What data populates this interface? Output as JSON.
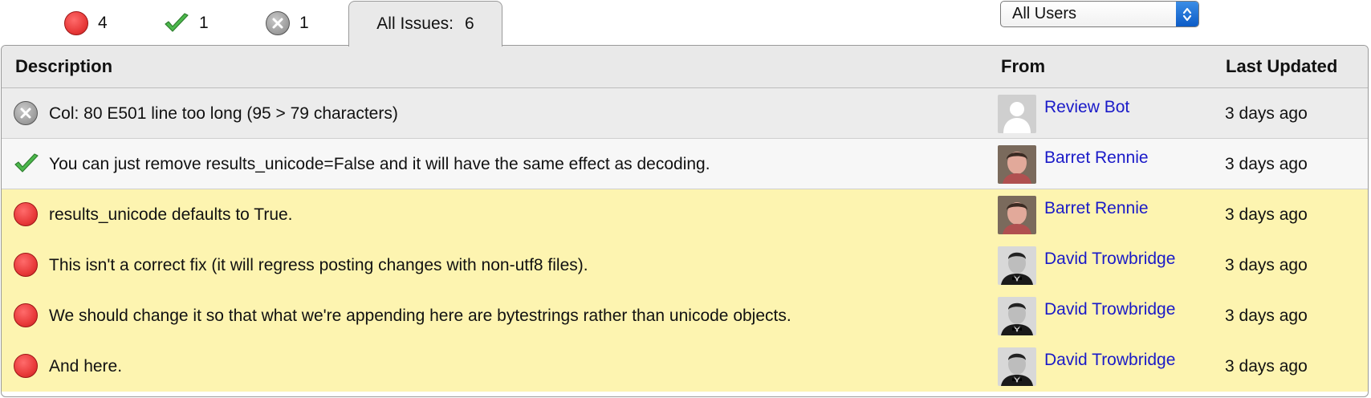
{
  "tabs": {
    "open": {
      "icon": "open-issue-icon",
      "count": "4"
    },
    "fixed": {
      "icon": "fixed-check-icon",
      "count": "1"
    },
    "dropped": {
      "icon": "dropped-x-icon",
      "count": "1"
    },
    "all": {
      "label": "All Issues:",
      "count": "6"
    }
  },
  "filter": {
    "selected": "All Users"
  },
  "table": {
    "headers": {
      "description": "Description",
      "from": "From",
      "last_updated": "Last Updated"
    },
    "rows": [
      {
        "status": "dropped",
        "description": "Col: 80 E501 line too long (95 > 79 characters)",
        "from": "Review Bot",
        "avatar": "default-avatar-icon",
        "updated": "3 days ago"
      },
      {
        "status": "fixed",
        "description": "You can just remove results_unicode=False and it will have the same effect as decoding.",
        "from": "Barret Rennie",
        "avatar": "user-avatar",
        "updated": "3 days ago"
      },
      {
        "status": "open",
        "description": "results_unicode defaults to True.",
        "from": "Barret Rennie",
        "avatar": "user-avatar",
        "updated": "3 days ago"
      },
      {
        "status": "open",
        "description": "This isn't a correct fix (it will regress posting changes with non-utf8 files).",
        "from": "David Trowbridge",
        "avatar": "user-avatar",
        "updated": "3 days ago"
      },
      {
        "status": "open",
        "description": "We should change it so that what we're appending here are bytestrings rather than unicode objects.",
        "from": "David Trowbridge",
        "avatar": "user-avatar",
        "updated": "3 days ago"
      },
      {
        "status": "open",
        "description": "And here.",
        "from": "David Trowbridge",
        "avatar": "user-avatar",
        "updated": "3 days ago"
      }
    ]
  },
  "colors": {
    "open": "#e83a3a",
    "fixed": "#3faa3f",
    "dropped": "#9a9a9a",
    "row_open_bg": "#fdf4b0",
    "link": "#1a1ac8",
    "select_accent": "#0d5cc7"
  }
}
